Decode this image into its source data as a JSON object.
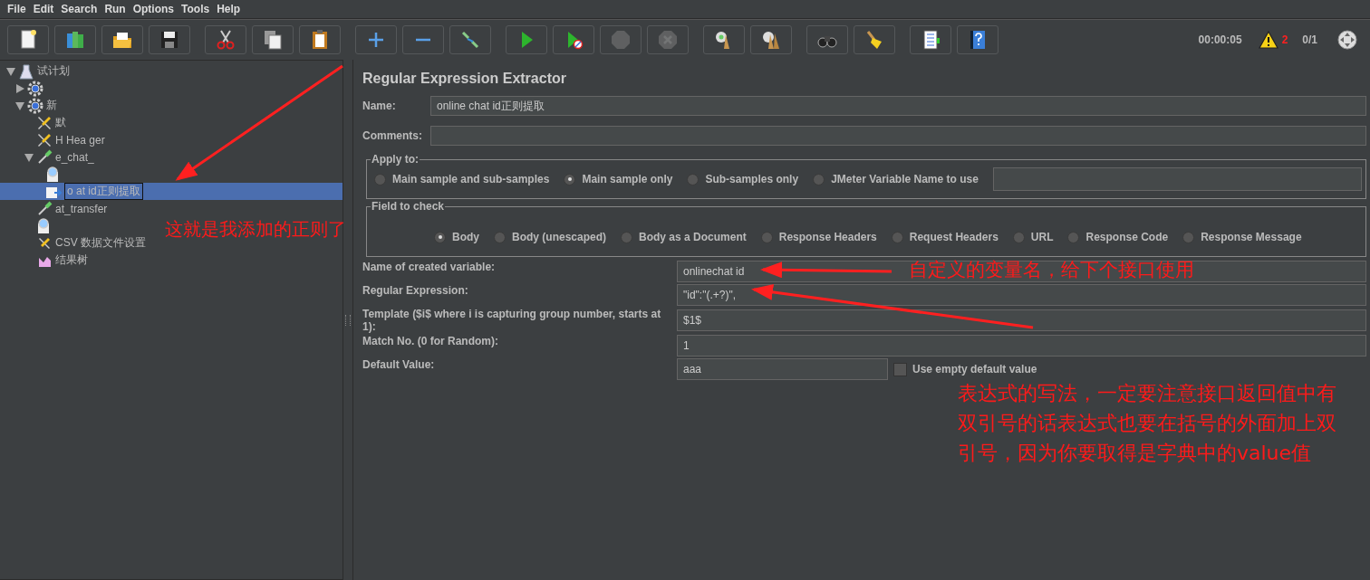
{
  "menu": [
    "File",
    "Edit",
    "Search",
    "Run",
    "Options",
    "Tools",
    "Help"
  ],
  "toolbar": [
    {
      "kind": "new",
      "disabled": false
    },
    {
      "kind": "templates",
      "disabled": false
    },
    {
      "kind": "open",
      "disabled": false
    },
    {
      "kind": "save",
      "disabled": false
    },
    {
      "kind": "cut",
      "disabled": false
    },
    {
      "kind": "copy",
      "disabled": false
    },
    {
      "kind": "paste",
      "disabled": false
    },
    {
      "kind": "expand",
      "disabled": false
    },
    {
      "kind": "collapse",
      "disabled": false
    },
    {
      "kind": "toggle",
      "disabled": false
    },
    {
      "kind": "start",
      "disabled": false
    },
    {
      "kind": "start-no-pause",
      "disabled": false
    },
    {
      "kind": "stop",
      "disabled": true
    },
    {
      "kind": "shutdown",
      "disabled": true
    },
    {
      "kind": "clear",
      "disabled": false
    },
    {
      "kind": "clear-all",
      "disabled": false
    },
    {
      "kind": "search",
      "disabled": false
    },
    {
      "kind": "reset",
      "disabled": false
    },
    {
      "kind": "functions",
      "disabled": false
    },
    {
      "kind": "help",
      "disabled": false
    }
  ],
  "status": {
    "elapsed": "00:00:05",
    "warnings": "2",
    "threads": "0/1"
  },
  "tree": [
    {
      "kind": "plan",
      "label": "试计划",
      "expanded": true,
      "selected": false,
      "children": [
        {
          "kind": "gear",
          "expanded": false,
          "selected": false
        },
        {
          "kind": "gear",
          "label": "新",
          "expanded": true,
          "selected": false,
          "children": [
            {
              "kind": "wrench",
              "label": "默",
              "selected": false
            },
            {
              "kind": "wrench",
              "label": "H Hea ger",
              "selected": false
            },
            {
              "kind": "sampler",
              "label": "e_chat_",
              "expanded": true,
              "selected": false,
              "children": [
                {
                  "kind": "magnifier",
                  "selected": false
                },
                {
                  "kind": "extractor",
                  "label": "o at id正则提取",
                  "selected": true
                }
              ]
            },
            {
              "kind": "sampler",
              "label": "at_transfer",
              "selected": false
            },
            {
              "kind": "magnifier",
              "selected": false
            },
            {
              "kind": "csv",
              "label": "CSV 数据文件设置",
              "selected": false
            },
            {
              "kind": "listener",
              "label": "结果树",
              "selected": false
            }
          ]
        }
      ]
    }
  ],
  "editor": {
    "title": "Regular Expression Extractor",
    "name": {
      "label": "Name:",
      "value": "online chat id正则提取"
    },
    "comments": {
      "label": "Comments:"
    },
    "apply_to": {
      "legend": "Apply to:",
      "options": [
        {
          "label": "Main sample and sub-samples",
          "selected": false
        },
        {
          "label": "Main sample only",
          "selected": true
        },
        {
          "label": "Sub-samples only",
          "selected": false
        },
        {
          "label": "JMeter Variable Name to use",
          "selected": false
        }
      ]
    },
    "field_to_check": {
      "legend": "Field to check",
      "options": [
        {
          "label": "Body",
          "selected": true
        },
        {
          "label": "Body (unescaped)",
          "selected": false
        },
        {
          "label": "Body as a Document",
          "selected": false
        },
        {
          "label": "Response Headers",
          "selected": false
        },
        {
          "label": "Request Headers",
          "selected": false
        },
        {
          "label": "URL",
          "selected": false
        },
        {
          "label": "Response Code",
          "selected": false
        },
        {
          "label": "Response Message",
          "selected": false
        }
      ]
    },
    "rows": [
      {
        "label": "Name of created variable:",
        "value": "onlinechat id"
      },
      {
        "label": "Regular Expression:",
        "value": "\"id\":\"(.+?)\","
      },
      {
        "label": "Template ($i$ where i is capturing group number, starts at 1):",
        "value": "$1$"
      },
      {
        "label": "Match No. (0 for Random):",
        "value": "1"
      },
      {
        "label": "Default Value:",
        "value": "aaa"
      }
    ],
    "use_empty_default": {
      "label": "Use empty default value",
      "checked": false
    }
  },
  "annotations": [
    {
      "text": "这就是我添加的正则了"
    },
    {
      "text": "自定义的变量名，给下个接口使用"
    },
    {
      "text": "表达式的写法，一定要注意接口返回值中有双引号的话表达式也要在括号的外面加上双引号，因为你要取得是字典中的value值"
    }
  ]
}
